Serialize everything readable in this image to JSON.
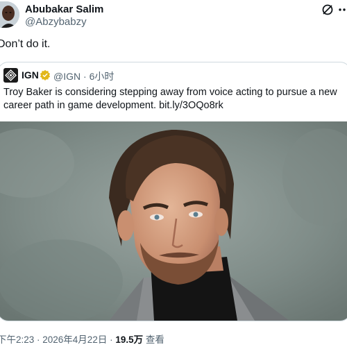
{
  "tweet": {
    "author_name": "Abubakar Salim",
    "author_handle": "@Abzybabzy",
    "text": "Don’t do it.",
    "timestamp": "下午2:23 · 2026年4月22日",
    "separator": "·",
    "views_count": "19.5万",
    "views_label": "查看",
    "avatar_icon": "profile-photo",
    "actions": {
      "grok_icon": "grok-icon",
      "more_icon": "more-icon"
    }
  },
  "quote": {
    "author_name": "IGN",
    "verified_icon": "gold-verified-badge-icon",
    "author_handle": "@IGN",
    "time_sep": "·",
    "relative_time": "6小时",
    "text_lines": [
      "Troy Baker is considering stepping away from voice acting to pursue a new",
      "career path in game development. bit.ly/3OQo8rk"
    ],
    "image_description_icon": "portrait-photo"
  },
  "colors": {
    "text": "#0f1419",
    "secondary": "#536471",
    "border": "#cfd9de",
    "verified_gold": "#e2b719"
  }
}
